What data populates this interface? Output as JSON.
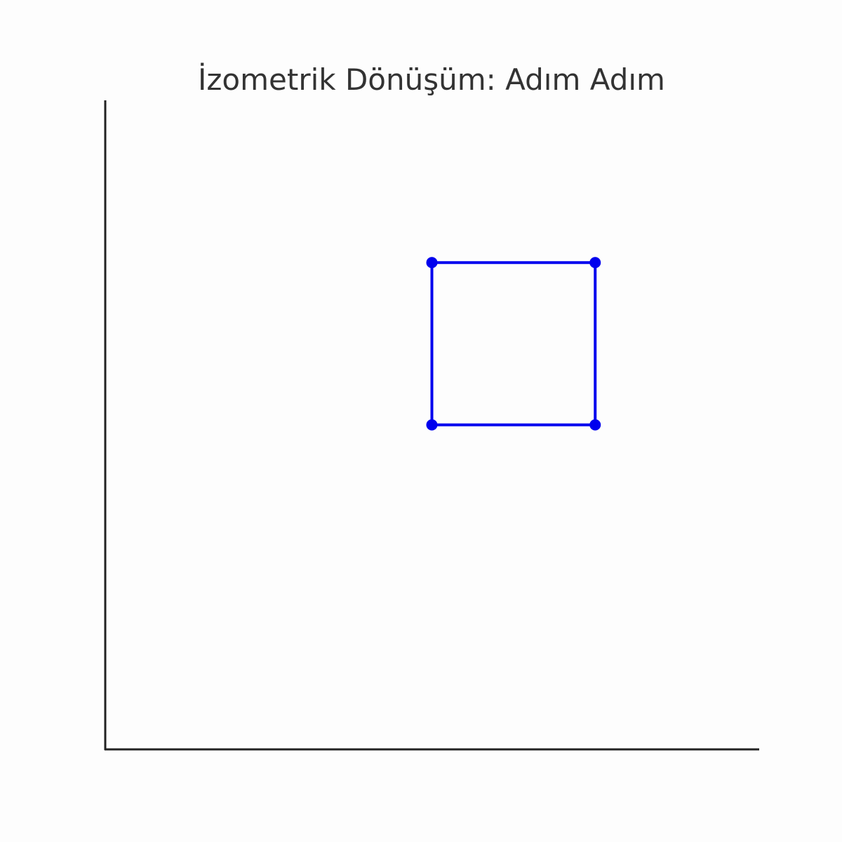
{
  "chart_data": {
    "type": "line",
    "title": "İzometrik Dönüşüm: Adım Adım",
    "xlabel": "",
    "ylabel": "",
    "xlim": [
      0,
      8
    ],
    "ylim": [
      0,
      8
    ],
    "grid": false,
    "axes_visible": [
      "left",
      "bottom"
    ],
    "ticks_visible": false,
    "series": [
      {
        "color": "#0000ee",
        "closed": true,
        "markers": true,
        "points": [
          [
            4,
            4
          ],
          [
            6,
            4
          ],
          [
            6,
            6
          ],
          [
            4,
            6
          ]
        ]
      }
    ]
  }
}
